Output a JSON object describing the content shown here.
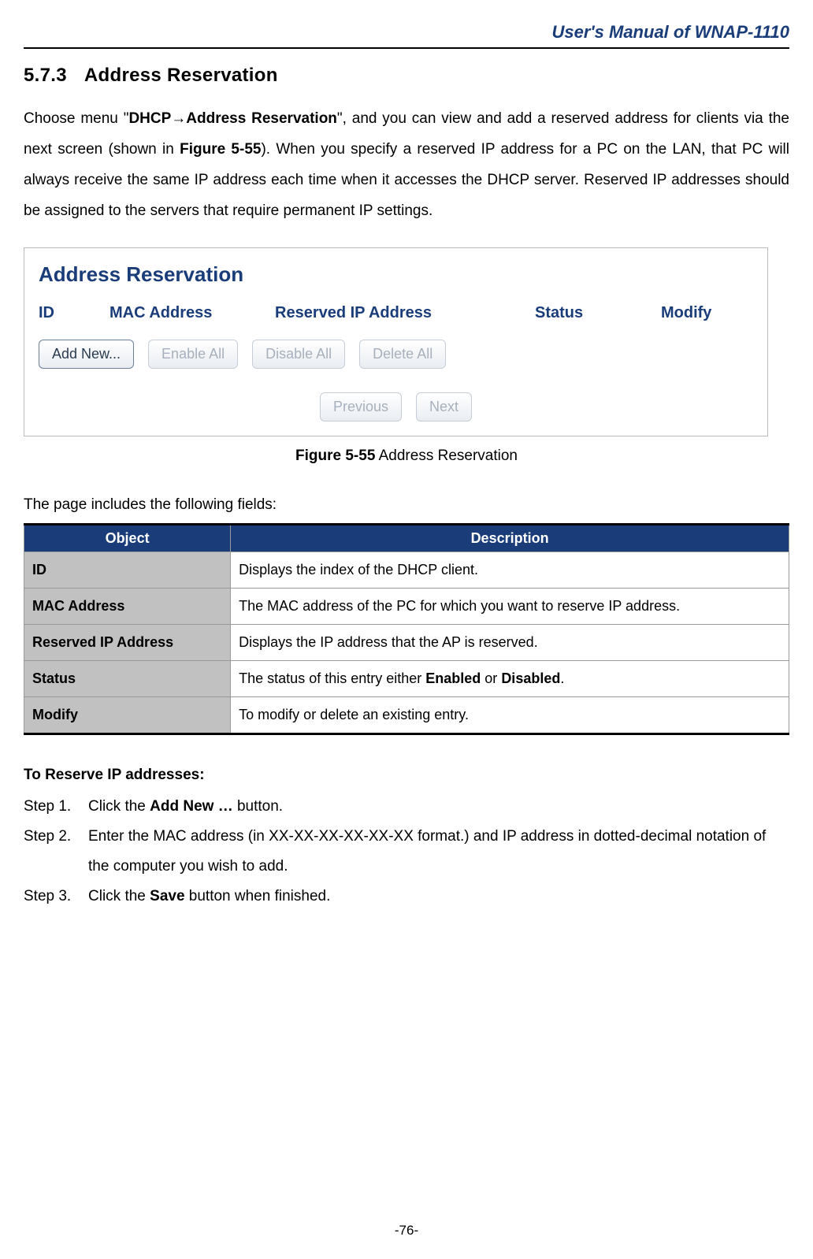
{
  "header": {
    "title": "User's  Manual  of  WNAP-1110"
  },
  "section": {
    "number": "5.7.3",
    "title": "Address Reservation"
  },
  "intro": {
    "pre": "Choose menu \"",
    "menu_bold": "DHCP→Address Reservation",
    "mid1": "\", and you can view and add a reserved address for clients via the next screen (shown in ",
    "figref": "Figure 5-55",
    "mid2": "). When you specify a reserved IP address for a PC on the LAN, that PC will always receive the same IP address each time when it accesses the DHCP server. Reserved IP addresses should be assigned to the servers that require permanent IP settings."
  },
  "figure": {
    "panel_title": "Address Reservation",
    "cols": [
      "ID",
      "MAC Address",
      "Reserved IP Address",
      "Status",
      "Modify"
    ],
    "buttons": {
      "add": "Add New...",
      "enable_all": "Enable All",
      "disable_all": "Disable All",
      "delete_all": "Delete All",
      "previous": "Previous",
      "next": "Next"
    },
    "caption_bold": "Figure 5-55",
    "caption_rest": "  Address Reservation"
  },
  "fields_intro": "The page includes the following fields:",
  "fields_table": {
    "head_object": "Object",
    "head_desc": "Description",
    "rows": [
      {
        "obj": "ID",
        "desc": "Displays the index of the DHCP client."
      },
      {
        "obj": "MAC Address",
        "desc": "The MAC address of the PC for which you want to reserve IP address."
      },
      {
        "obj": "Reserved IP Address",
        "desc": "Displays the IP address that the AP is reserved."
      },
      {
        "obj": "Status",
        "desc_pre": "The status of this entry either ",
        "b1": "Enabled",
        "mid": " or ",
        "b2": "Disabled",
        "post": "."
      },
      {
        "obj": "Modify",
        "desc": "To modify or delete an existing entry."
      }
    ]
  },
  "reserve": {
    "heading": "To Reserve IP addresses:",
    "steps": [
      {
        "label": "Step 1.",
        "pre": "Click the ",
        "bold": "Add New …",
        "post": " button."
      },
      {
        "label": "Step 2.",
        "pre": "Enter the MAC address (in XX-XX-XX-XX-XX-XX format.) and IP address in dotted-decimal notation of the computer you wish to add."
      },
      {
        "label": "Step 3.",
        "pre": "Click the ",
        "bold": "Save",
        "post": " button when finished."
      }
    ]
  },
  "page_number": "-76-"
}
